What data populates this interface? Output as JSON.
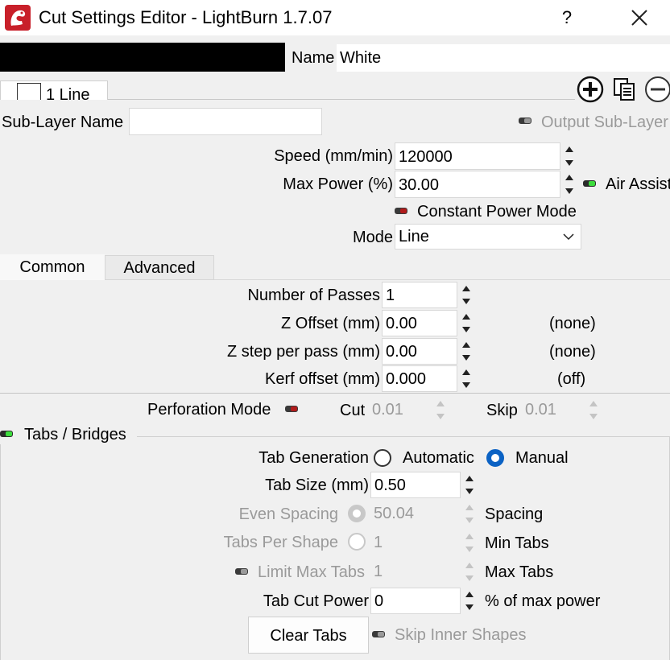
{
  "window": {
    "title": "Cut Settings Editor - LightBurn 1.7.07",
    "help": "?",
    "close": "✕"
  },
  "name_row": {
    "label": "Name",
    "value": "White",
    "color": "#000000"
  },
  "layer_tab": {
    "label": "1 Line"
  },
  "sublayer": {
    "label": "Sub-Layer Name",
    "value": "",
    "output_label": "Output Sub-Layer"
  },
  "speed": {
    "label": "Speed (mm/min)",
    "value": "120000"
  },
  "max_power": {
    "label": "Max Power (%)",
    "value": "30.00"
  },
  "air_assist": {
    "label": "Air Assist",
    "on": true
  },
  "constant_power": {
    "label": "Constant Power Mode",
    "on": false
  },
  "mode": {
    "label": "Mode",
    "value": "Line"
  },
  "tabs": {
    "common": "Common",
    "advanced": "Advanced"
  },
  "passes": {
    "label": "Number of Passes",
    "value": "1"
  },
  "z_offset": {
    "label": "Z Offset (mm)",
    "value": "0.00",
    "note": "(none)"
  },
  "z_step": {
    "label": "Z step per pass (mm)",
    "value": "0.00",
    "note": "(none)"
  },
  "kerf": {
    "label": "Kerf offset (mm)",
    "value": "0.000",
    "note": "(off)"
  },
  "perforation": {
    "label": "Perforation Mode",
    "cut_label": "Cut",
    "cut_value": "0.01",
    "skip_label": "Skip",
    "skip_value": "0.01"
  },
  "tabs_bridges": {
    "label": "Tabs / Bridges",
    "generation_label": "Tab Generation",
    "automatic": "Automatic",
    "manual": "Manual",
    "size_label": "Tab Size (mm)",
    "size_value": "0.50",
    "even_spacing_label": "Even Spacing",
    "even_spacing_value": "50.04",
    "spacing_unit": "Spacing",
    "per_shape_label": "Tabs Per Shape",
    "per_shape_value": "1",
    "min_tabs_unit": "Min Tabs",
    "limit_label": "Limit Max Tabs",
    "limit_value": "1",
    "max_tabs_unit": "Max Tabs",
    "cut_power_label": "Tab Cut Power",
    "cut_power_value": "0",
    "cut_power_unit": "% of max power",
    "clear_button": "Clear Tabs",
    "skip_inner_label": "Skip Inner Shapes"
  }
}
